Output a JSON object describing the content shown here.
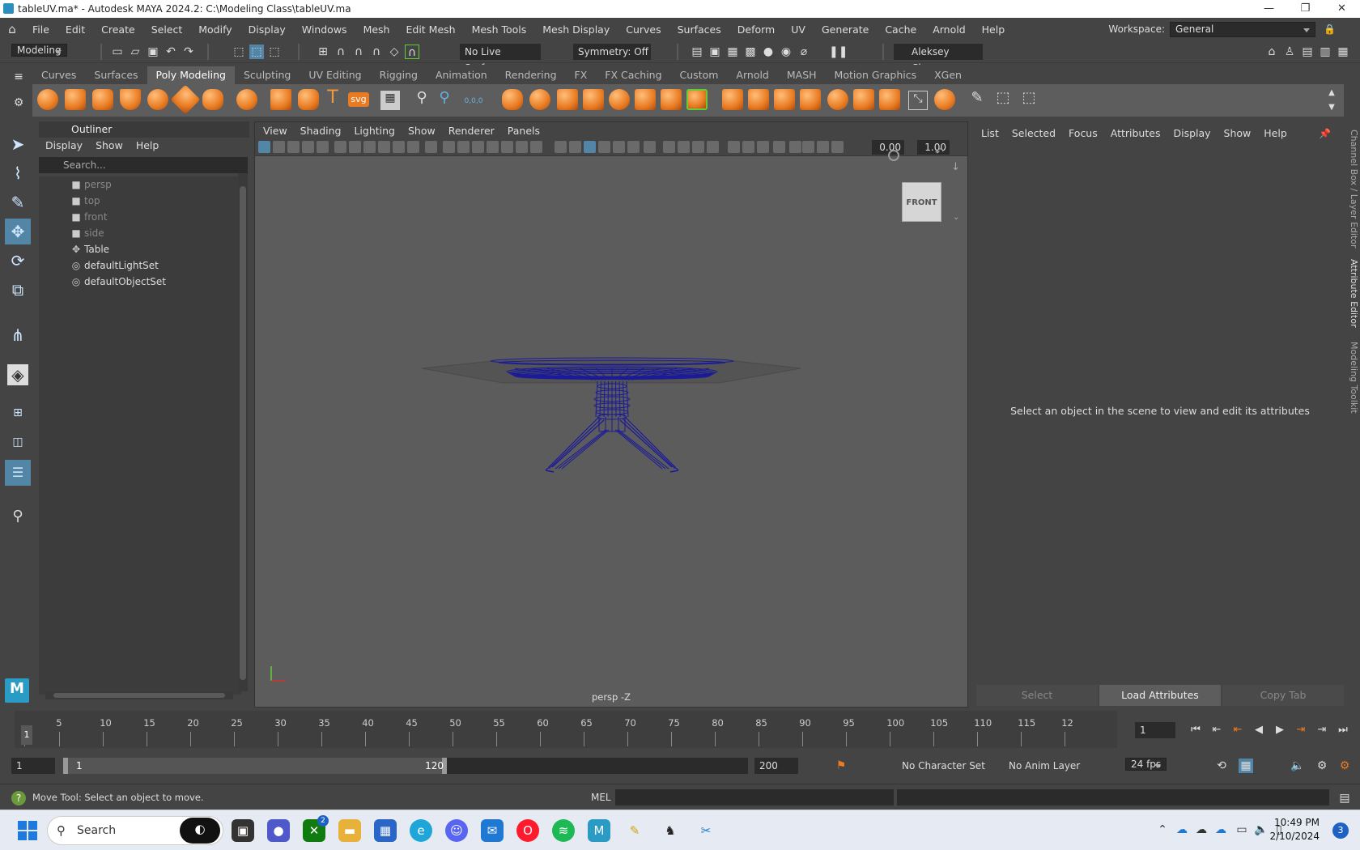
{
  "window": {
    "title": "tableUV.ma* - Autodesk MAYA 2024.2: C:\\Modeling Class\\tableUV.ma",
    "minimize": "—",
    "restore": "❐",
    "close": "✕"
  },
  "menubar": {
    "items": [
      "File",
      "Edit",
      "Create",
      "Select",
      "Modify",
      "Display",
      "Windows",
      "Mesh",
      "Edit Mesh",
      "Mesh Tools",
      "Mesh Display",
      "Curves",
      "Surfaces",
      "Deform",
      "UV",
      "Generate",
      "Cache",
      "Arnold",
      "Help"
    ],
    "workspace_label": "Workspace:",
    "workspace_value": "General"
  },
  "statusline": {
    "menu_set": "Modeling",
    "live_surface": "No Live Surface",
    "symmetry": "Symmetry: Off",
    "user": "Aleksey Chuma.."
  },
  "shelf": {
    "tabs": [
      "Curves",
      "Surfaces",
      "Poly Modeling",
      "Sculpting",
      "UV Editing",
      "Rigging",
      "Animation",
      "Rendering",
      "FX",
      "FX Caching",
      "Custom",
      "Arnold",
      "MASH",
      "Motion Graphics",
      "XGen"
    ],
    "active_tab": "Poly Modeling",
    "text_tool": "T",
    "svg_tool": "svg",
    "coords": "0,0,0"
  },
  "outliner": {
    "title": "Outliner",
    "menu": [
      "Display",
      "Show",
      "Help"
    ],
    "search_placeholder": "Search...",
    "items": [
      {
        "label": "persp",
        "icon": "camera-icon",
        "dim": true
      },
      {
        "label": "top",
        "icon": "camera-icon",
        "dim": true
      },
      {
        "label": "front",
        "icon": "camera-icon",
        "dim": true
      },
      {
        "label": "side",
        "icon": "camera-icon",
        "dim": true
      },
      {
        "label": "Table",
        "icon": "transform-icon",
        "dim": false
      },
      {
        "label": "defaultLightSet",
        "icon": "set-icon",
        "dim": false
      },
      {
        "label": "defaultObjectSet",
        "icon": "set-icon",
        "dim": false
      }
    ]
  },
  "viewport": {
    "menu": [
      "View",
      "Shading",
      "Lighting",
      "Show",
      "Renderer",
      "Panels"
    ],
    "exposure": "0.00",
    "gamma": "1.00",
    "viewcube_label": "FRONT",
    "camera_label": "persp -Z",
    "wire_color": "#1a1a9a"
  },
  "attribute_editor": {
    "menu": [
      "List",
      "Selected",
      "Focus",
      "Attributes",
      "Display",
      "Show",
      "Help"
    ],
    "message": "Select an object in the scene to view and edit its attributes",
    "buttons": {
      "select": "Select",
      "load": "Load Attributes",
      "copy": "Copy Tab"
    }
  },
  "side_tabs": [
    "Channel Box / Layer Editor",
    "Attribute Editor",
    "Modeling Toolkit"
  ],
  "timeline": {
    "ticks": [
      "5",
      "10",
      "15",
      "20",
      "25",
      "30",
      "35",
      "40",
      "45",
      "50",
      "55",
      "60",
      "65",
      "70",
      "75",
      "80",
      "85",
      "90",
      "95",
      "100",
      "105",
      "110",
      "115",
      "12"
    ],
    "current_frame": "1",
    "frame_field": "1"
  },
  "range": {
    "start": "1",
    "range_start": "1",
    "range_end": "120",
    "end": "200",
    "character_set": "No Character Set",
    "anim_layer": "No Anim Layer",
    "fps": "24 fps"
  },
  "help_line": {
    "text": "Move Tool: Select an object to move.",
    "mel": "MEL"
  },
  "taskbar": {
    "search": "Search",
    "time": "10:49 PM",
    "date": "2/10/2024",
    "notifications": "3",
    "xbox_badge": "2"
  }
}
